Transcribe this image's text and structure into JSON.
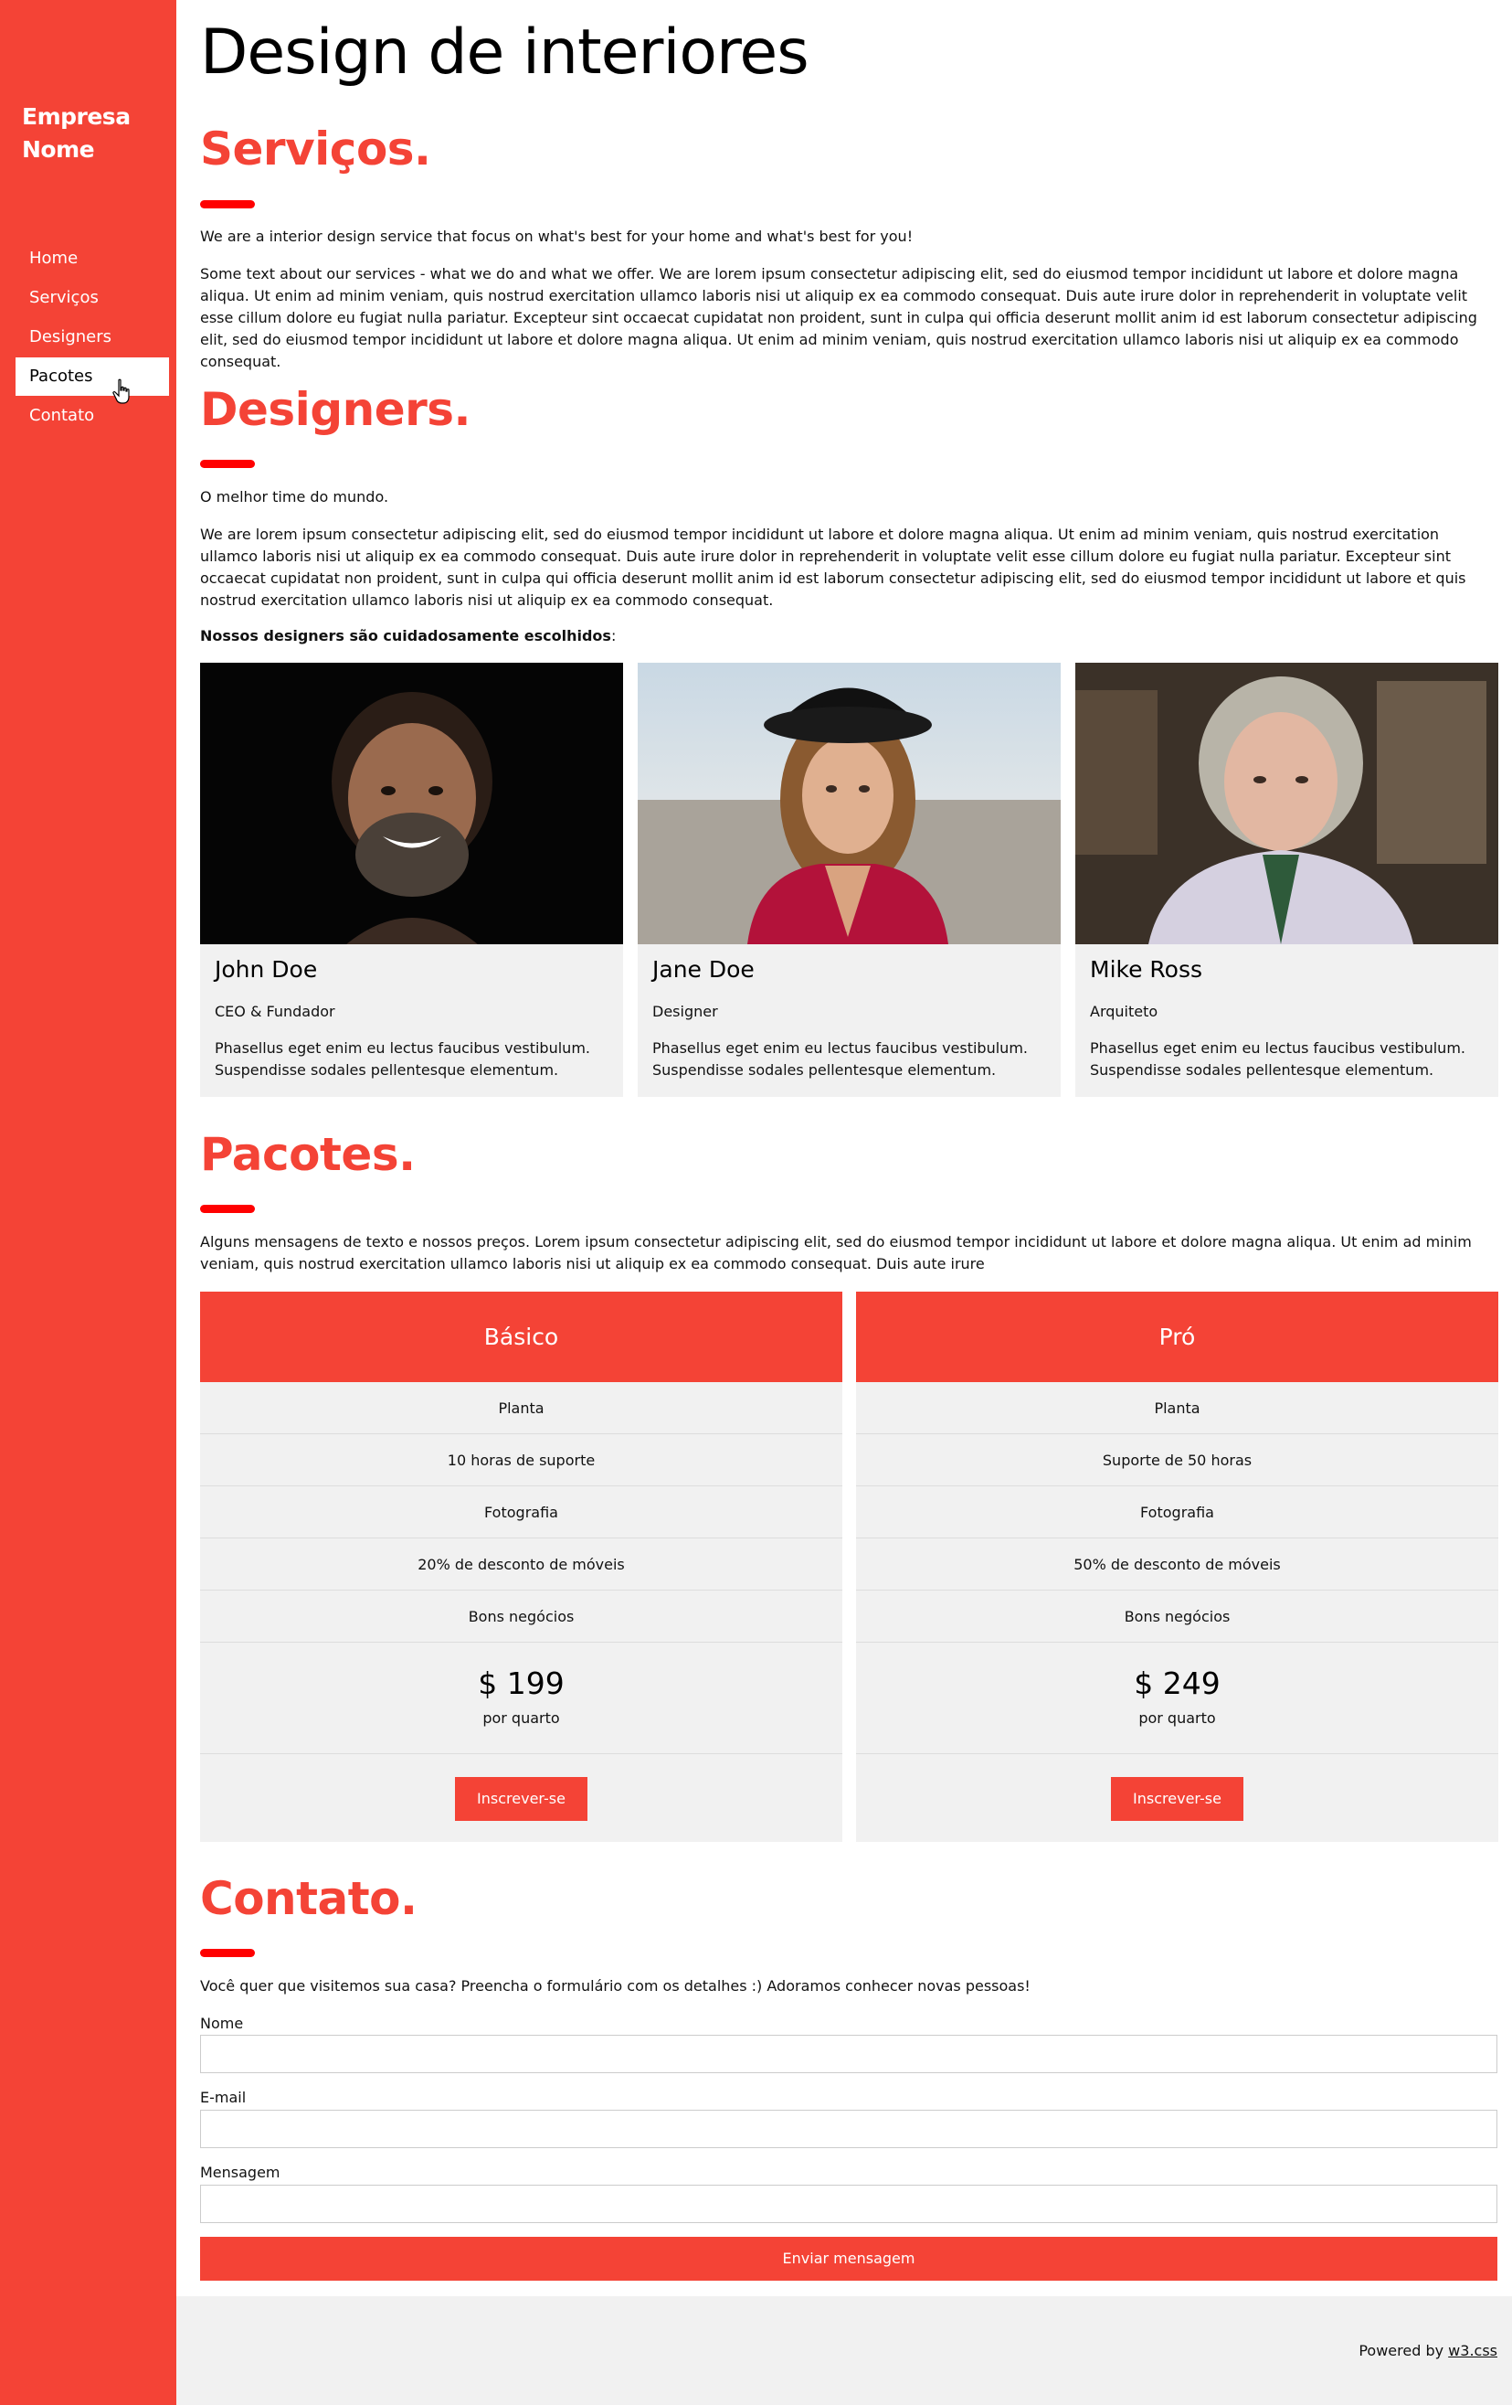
{
  "brand": {
    "line1": "Empresa",
    "line2": "Nome"
  },
  "nav": {
    "items": [
      {
        "label": "Home",
        "active": false
      },
      {
        "label": "Serviços",
        "active": false
      },
      {
        "label": "Designers",
        "active": false
      },
      {
        "label": "Pacotes",
        "active": true
      },
      {
        "label": "Contato",
        "active": false
      }
    ]
  },
  "header": {
    "title": "Design de interiores"
  },
  "services": {
    "title": "Serviços.",
    "intro": "We are a interior design service that focus on what's best for your home and what's best for you!",
    "body": "Some text about our services - what we do and what we offer. We are lorem ipsum consectetur adipiscing elit, sed do eiusmod tempor incididunt ut labore et dolore magna aliqua. Ut enim ad minim veniam, quis nostrud exercitation ullamco laboris nisi ut aliquip ex ea commodo consequat. Duis aute irure dolor in reprehenderit in voluptate velit esse cillum dolore eu fugiat nulla pariatur. Excepteur sint occaecat cupidatat non proident, sunt in culpa qui officia deserunt mollit anim id est laborum consectetur adipiscing elit, sed do eiusmod tempor incididunt ut labore et dolore magna aliqua. Ut enim ad minim veniam, quis nostrud exercitation ullamco laboris nisi ut aliquip ex ea commodo consequat."
  },
  "designers": {
    "title": "Designers.",
    "intro": "O melhor time do mundo.",
    "body": "We are lorem ipsum consectetur adipiscing elit, sed do eiusmod tempor incididunt ut labore et dolore magna aliqua. Ut enim ad minim veniam, quis nostrud exercitation ullamco laboris nisi ut aliquip ex ea commodo consequat. Duis aute irure dolor in reprehenderit in voluptate velit esse cillum dolore eu fugiat nulla pariatur. Excepteur sint occaecat cupidatat non proident, sunt in culpa qui officia deserunt mollit anim id est laborum consectetur adipiscing elit, sed do eiusmod tempor incididunt ut labore et quis nostrud exercitation ullamco laboris nisi ut aliquip ex ea commodo consequat.",
    "lead": "Nossos designers são cuidadosamente escolhidos",
    "lead_suffix": ":",
    "people": [
      {
        "name": "John Doe",
        "role": "CEO & Fundador",
        "desc": "Phasellus eget enim eu lectus faucibus vestibulum. Suspendisse sodales pellentesque elementum."
      },
      {
        "name": "Jane Doe",
        "role": "Designer",
        "desc": "Phasellus eget enim eu lectus faucibus vestibulum. Suspendisse sodales pellentesque elementum."
      },
      {
        "name": "Mike Ross",
        "role": "Arquiteto",
        "desc": "Phasellus eget enim eu lectus faucibus vestibulum. Suspendisse sodales pellentesque elementum."
      }
    ]
  },
  "packages": {
    "title": "Pacotes.",
    "body": "Alguns mensagens de texto e nossos preços. Lorem ipsum consectetur adipiscing elit, sed do eiusmod tempor incididunt ut labore et dolore magna aliqua. Ut enim ad minim veniam, quis nostrud exercitation ullamco laboris nisi ut aliquip ex ea commodo consequat. Duis aute irure",
    "plans": [
      {
        "name": "Básico",
        "features": [
          "Planta",
          "10 horas de suporte",
          "Fotografia",
          "20% de desconto de móveis",
          "Bons negócios"
        ],
        "price": "$ 199",
        "per": "por quarto",
        "cta": "Inscrever-se"
      },
      {
        "name": "Pró",
        "features": [
          "Planta",
          "Suporte de 50 horas",
          "Fotografia",
          "50% de desconto de móveis",
          "Bons negócios"
        ],
        "price": "$ 249",
        "per": "por quarto",
        "cta": "Inscrever-se"
      }
    ]
  },
  "contact": {
    "title": "Contato.",
    "intro": "Você quer que visitemos sua casa? Preencha o formulário com os detalhes :) Adoramos conhecer novas pessoas!",
    "fields": [
      {
        "label": "Nome",
        "value": "",
        "placeholder": ""
      },
      {
        "label": "E-mail",
        "value": "",
        "placeholder": ""
      },
      {
        "label": "Mensagem",
        "value": "",
        "placeholder": ""
      }
    ],
    "submit": "Enviar mensagem"
  },
  "footer": {
    "prefix": "Powered by",
    "link": "w3.css"
  },
  "colors": {
    "accent": "#f44336",
    "bar": "#ff0000",
    "card_bg": "#f1f1f1"
  }
}
